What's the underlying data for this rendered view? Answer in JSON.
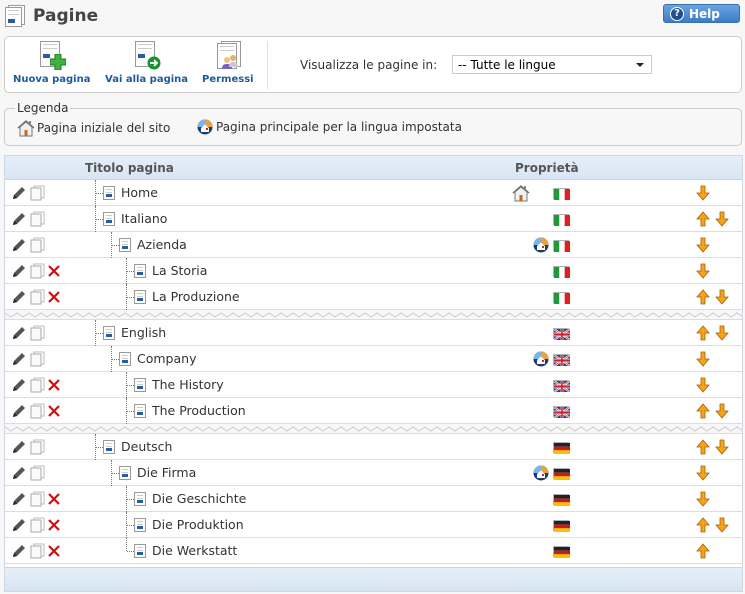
{
  "header": {
    "title": "Pagine",
    "help_label": "Help"
  },
  "toolbar": {
    "new_page": "Nuova pagina",
    "go_to_page": "Vai alla pagina",
    "permissions": "Permessi",
    "filter_label": "Visualizza le pagine in:",
    "filter_value": "-- Tutte le lingue"
  },
  "legend": {
    "title": "Legenda",
    "site_home": "Pagina iniziale del sito",
    "lang_home": "Pagina principale per la lingua impostata"
  },
  "table": {
    "col_title": "Titolo pagina",
    "col_props": "Proprietà",
    "groups": [
      {
        "rows": [
          {
            "title": "Home",
            "level": 0,
            "deletable": false,
            "site_home": true,
            "lang_home": false,
            "lang": "it",
            "up": false,
            "down": true
          },
          {
            "title": "Italiano",
            "level": 0,
            "deletable": false,
            "site_home": false,
            "lang_home": false,
            "lang": "it",
            "up": true,
            "down": true
          },
          {
            "title": "Azienda",
            "level": 1,
            "deletable": false,
            "site_home": false,
            "lang_home": true,
            "lang": "it",
            "up": false,
            "down": true
          },
          {
            "title": "La Storia",
            "level": 2,
            "deletable": true,
            "site_home": false,
            "lang_home": false,
            "lang": "it",
            "up": false,
            "down": true
          },
          {
            "title": "La Produzione",
            "level": 2,
            "deletable": true,
            "site_home": false,
            "lang_home": false,
            "lang": "it",
            "up": true,
            "down": true
          }
        ]
      },
      {
        "rows": [
          {
            "title": "English",
            "level": 0,
            "deletable": false,
            "site_home": false,
            "lang_home": false,
            "lang": "en",
            "up": true,
            "down": true
          },
          {
            "title": "Company",
            "level": 1,
            "deletable": false,
            "site_home": false,
            "lang_home": true,
            "lang": "en",
            "up": false,
            "down": true
          },
          {
            "title": "The History",
            "level": 2,
            "deletable": true,
            "site_home": false,
            "lang_home": false,
            "lang": "en",
            "up": false,
            "down": true
          },
          {
            "title": "The Production",
            "level": 2,
            "deletable": true,
            "site_home": false,
            "lang_home": false,
            "lang": "en",
            "up": true,
            "down": true
          }
        ]
      },
      {
        "rows": [
          {
            "title": "Deutsch",
            "level": 0,
            "deletable": false,
            "site_home": false,
            "lang_home": false,
            "lang": "de",
            "up": true,
            "down": true
          },
          {
            "title": "Die Firma",
            "level": 1,
            "deletable": false,
            "site_home": false,
            "lang_home": true,
            "lang": "de",
            "up": false,
            "down": true
          },
          {
            "title": "Die Geschichte",
            "level": 2,
            "deletable": true,
            "site_home": false,
            "lang_home": false,
            "lang": "de",
            "up": false,
            "down": true
          },
          {
            "title": "Die Produktion",
            "level": 2,
            "deletable": true,
            "site_home": false,
            "lang_home": false,
            "lang": "de",
            "up": true,
            "down": true
          },
          {
            "title": "Die Werkstatt",
            "level": 2,
            "deletable": true,
            "site_home": false,
            "lang_home": false,
            "lang": "de",
            "up": true,
            "down": false
          }
        ]
      }
    ]
  },
  "colors": {
    "accent": "#1d5a9c",
    "arrow": "#f7a21b",
    "delete": "#d01010"
  }
}
